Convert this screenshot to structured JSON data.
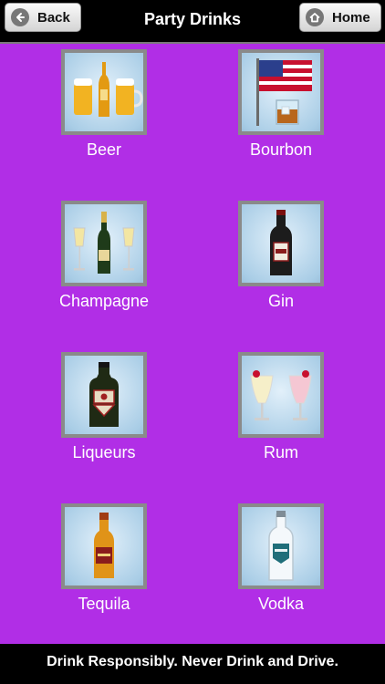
{
  "header": {
    "title": "Party Drinks",
    "back_label": "Back",
    "home_label": "Home",
    "back_icon": "arrow-left-circle-icon",
    "home_icon": "home-icon"
  },
  "drinks": [
    {
      "label": "Beer",
      "icon": "beer-icon"
    },
    {
      "label": "Bourbon",
      "icon": "bourbon-icon"
    },
    {
      "label": "Champagne",
      "icon": "champagne-icon"
    },
    {
      "label": "Gin",
      "icon": "gin-icon"
    },
    {
      "label": "Liqueurs",
      "icon": "liqueur-icon"
    },
    {
      "label": "Rum",
      "icon": "rum-cocktail-icon"
    },
    {
      "label": "Tequila",
      "icon": "tequila-icon"
    },
    {
      "label": "Vodka",
      "icon": "vodka-icon"
    }
  ],
  "footer": {
    "message": "Drink Responsibly. Never Drink and Drive."
  },
  "colors": {
    "background": "#b12ee6",
    "bar": "#000000"
  }
}
